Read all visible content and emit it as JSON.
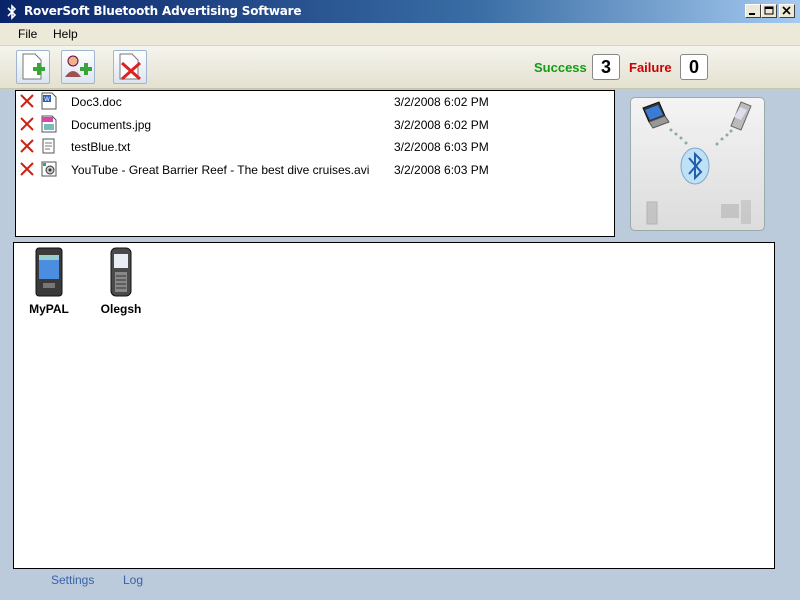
{
  "window": {
    "title": "RoverSoft Bluetooth Advertising Software"
  },
  "menu": {
    "items": [
      "File",
      "Help"
    ]
  },
  "toolbar": {
    "buttons": [
      "add-file-icon",
      "add-device-icon",
      "remove-icon"
    ]
  },
  "stats": {
    "success_label": "Success",
    "success_value": "3",
    "failure_label": "Failure",
    "failure_value": "0",
    "success_color": "#129d12",
    "failure_color": "#cc0000"
  },
  "files": [
    {
      "name": "Doc3.doc",
      "date": "3/2/2008 6:02 PM",
      "icon": "word-doc-icon"
    },
    {
      "name": "Documents.jpg",
      "date": "3/2/2008 6:02 PM",
      "icon": "image-file-icon"
    },
    {
      "name": "testBlue.txt",
      "date": "3/2/2008 6:03 PM",
      "icon": "text-file-icon"
    },
    {
      "name": "YouTube - Great Barrier Reef - The best dive cruises.avi",
      "date": "3/2/2008 6:03 PM",
      "icon": "video-file-icon"
    }
  ],
  "devices": [
    {
      "name": "MyPAL",
      "icon": "pda-icon"
    },
    {
      "name": "Olegsh",
      "icon": "mobile-phone-icon"
    }
  ],
  "bottom_links": {
    "settings": "Settings",
    "log": "Log"
  }
}
